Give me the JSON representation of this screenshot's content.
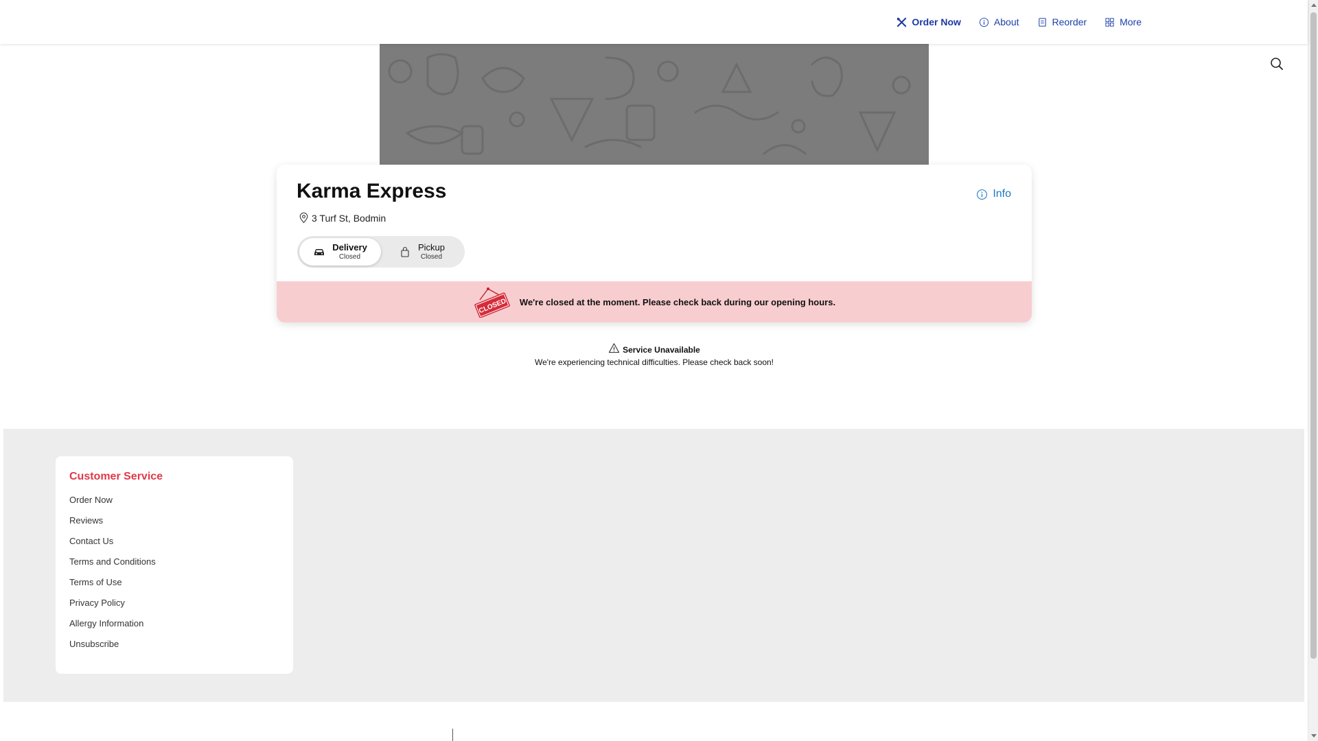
{
  "nav": {
    "items": [
      {
        "label": "Order Now",
        "icon": "utensils-icon",
        "active": true
      },
      {
        "label": "About",
        "icon": "info-circle-icon"
      },
      {
        "label": "Reorder",
        "icon": "receipt-icon"
      },
      {
        "label": "More",
        "icon": "grid-icon"
      }
    ]
  },
  "search": {
    "icon": "search-icon"
  },
  "restaurant": {
    "name": "Karma Express",
    "address": "3 Turf St, Bodmin",
    "info_label": "Info"
  },
  "modes": {
    "delivery": {
      "label": "Delivery",
      "status": "Closed",
      "selected": true
    },
    "pickup": {
      "label": "Pickup",
      "status": "Closed",
      "selected": false
    }
  },
  "closed_banner": {
    "sign_text": "CLOSED",
    "message": "We're closed at the moment. Please check back during our opening hours."
  },
  "service": {
    "title": "Service Unavailable",
    "message": "We're experiencing technical difficulties. Please check back soon!"
  },
  "footer": {
    "customer_service": {
      "title": "Customer Service",
      "links": [
        "Order Now",
        "Reviews",
        "Contact Us",
        "Terms and Conditions",
        "Terms of Use",
        "Privacy Policy",
        "Allergy Information",
        "Unsubscribe"
      ]
    }
  },
  "colors": {
    "nav_link": "#1a3faa",
    "info_link": "#1a78c2",
    "closed_banner_bg": "#f8cdd0",
    "closed_sign": "#d62b3a",
    "cs_title": "#e0394a",
    "footer_bg": "#ededed",
    "hero_bg": "#7c7c7c"
  }
}
